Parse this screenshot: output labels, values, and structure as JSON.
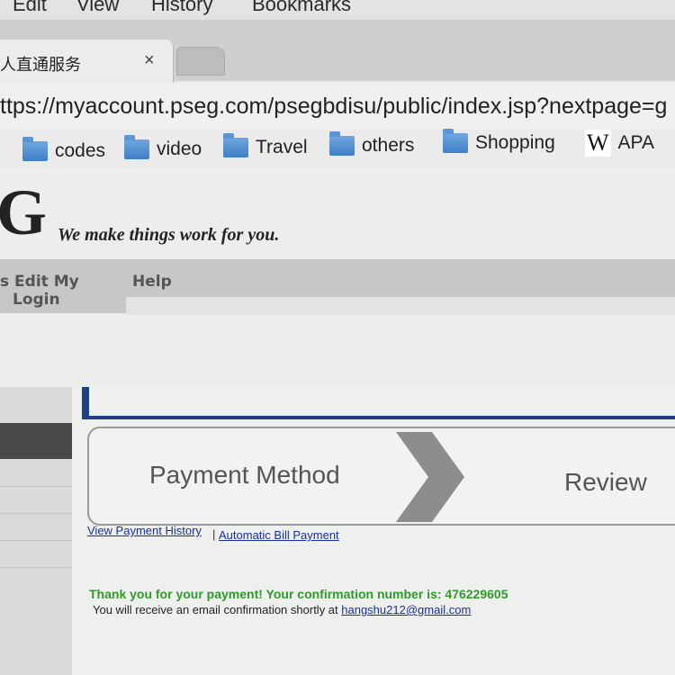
{
  "menubar": {
    "edit": "Edit",
    "view": "View",
    "history": "History",
    "bookmarks": "Bookmarks"
  },
  "tab": {
    "title": "人直通服务",
    "close": "×"
  },
  "address": {
    "url": "ttps://myaccount.pseg.com/psegbdisu/public/index.jsp?nextpage=g"
  },
  "bookmarks": [
    "codes",
    "video",
    "Travel",
    "others",
    "Shopping",
    "APA"
  ],
  "wiki_glyph": "W",
  "site": {
    "logo": "G",
    "tagline": "We make things work for you."
  },
  "nav": {
    "item1_line1": "s Edit My",
    "item1_line2": "Login",
    "item2": "Help"
  },
  "steps": {
    "step1": "Payment Method",
    "step2": "Review"
  },
  "links": {
    "history": "View Payment History",
    "separator": "|",
    "autopay": "Automatic Bill Payment"
  },
  "confirmation": {
    "thanks": "Thank you for your payment! Your confirmation number is: 476229605",
    "email_prefix": "You will receive an email confirmation shortly at ",
    "email": "hangshu212@gmail.com"
  }
}
